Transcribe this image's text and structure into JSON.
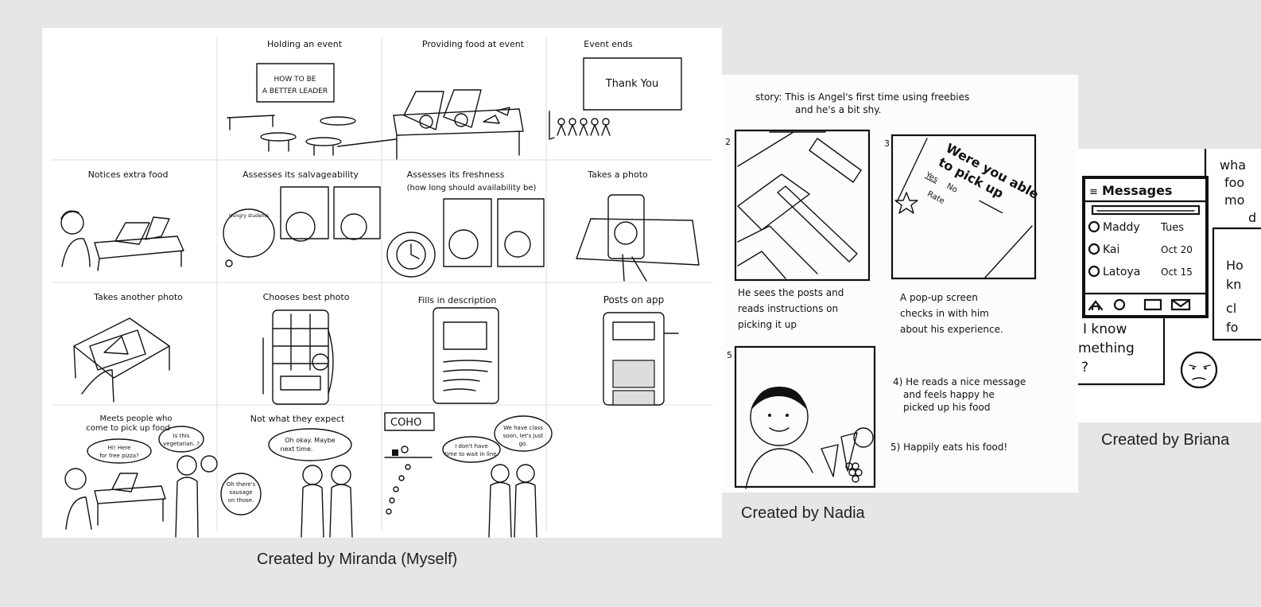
{
  "boards": {
    "miranda": {
      "caption": "Created by Miranda (Myself)",
      "panels": [
        {
          "title": "Holding an event",
          "sign": "HOW TO BE A BETTER LEADER"
        },
        {
          "title": "Providing food at event"
        },
        {
          "title": "Event ends",
          "sign": "Thank You"
        },
        {
          "title": "Notices extra food"
        },
        {
          "title": "Assesses its salvageability",
          "bubble": "Hungry students"
        },
        {
          "title": "Assesses its freshness",
          "subtitle": "(how long should availability be)"
        },
        {
          "title": "Takes a photo"
        },
        {
          "title": "Takes another photo"
        },
        {
          "title": "Chooses best photo"
        },
        {
          "title": "Fills in description"
        },
        {
          "title": "Posts on app"
        },
        {
          "title": "Meets people who come to pick up food",
          "bubbles": [
            "Hi! Here for free pizza?",
            "Is this vegetarian..?"
          ]
        },
        {
          "title": "Not what they expect",
          "bubbles": [
            "Oh okay. Maybe next time.",
            "Oh there's sausage on those."
          ]
        },
        {
          "title": "COHO",
          "bubbles": [
            "I don't have time to wait in line.",
            "We have class soon, let's just go."
          ]
        }
      ]
    },
    "nadia": {
      "caption": "Created by Nadia",
      "story": "story: This is Angel's first time using freebies and he's a bit shy.",
      "frame_numbers": [
        "2",
        "3",
        "5"
      ],
      "popup_text": "Were you able to pick up",
      "popup_options": [
        "Yes",
        "No"
      ],
      "popup_rate": "Rate",
      "notes": [
        "He sees the posts and reads instructions on picking it up",
        "A pop-up screen checks in with him about his experience.",
        "4) He reads a nice message and feels happy he picked up his food",
        "5) Happily eats his food!"
      ]
    },
    "briana": {
      "caption": "Created by Briana",
      "screen_title": "Messages",
      "contacts": [
        {
          "name": "Maddy",
          "date": "Tues"
        },
        {
          "name": "Kai",
          "date": "Oct 20"
        },
        {
          "name": "Latoya",
          "date": "Oct 15"
        }
      ],
      "side_text": [
        "wha",
        "foo",
        "mo",
        "d",
        "Ho",
        "kn",
        "cl",
        "fo"
      ],
      "bottom_text": [
        "I know",
        "mething",
        "?"
      ]
    }
  }
}
